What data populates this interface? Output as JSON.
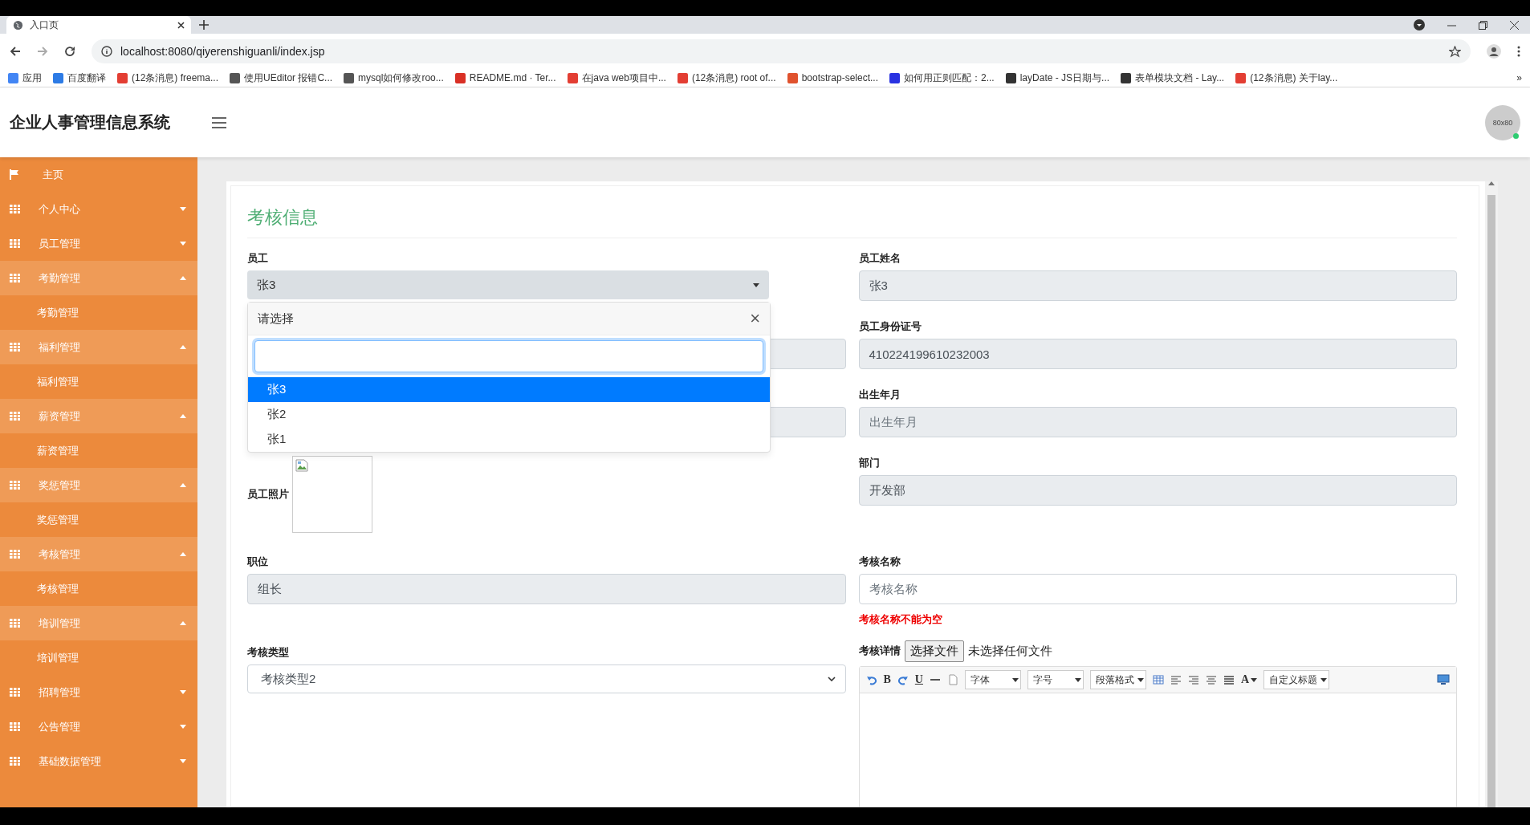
{
  "browser": {
    "tab_title": "入口页",
    "url": "localhost:8080/qiyerenshiguanli/index.jsp",
    "bookmarks": [
      {
        "label": "应用",
        "color": "#4285f4"
      },
      {
        "label": "百度翻译",
        "color": "#2d7be5"
      },
      {
        "label": "(12条消息) freema...",
        "color": "#e33e33"
      },
      {
        "label": "使用UEditor 报错C...",
        "color": "#555555"
      },
      {
        "label": "mysql如何修改roo...",
        "color": "#555555"
      },
      {
        "label": "README.md · Ter...",
        "color": "#d93025"
      },
      {
        "label": "在java web项目中...",
        "color": "#e33e33"
      },
      {
        "label": "(12条消息) root of...",
        "color": "#e33e33"
      },
      {
        "label": "bootstrap-select...",
        "color": "#e0522e"
      },
      {
        "label": "如何用正则匹配：2...",
        "color": "#2932e1"
      },
      {
        "label": "layDate - JS日期与...",
        "color": "#333333"
      },
      {
        "label": "表单模块文档 - Lay...",
        "color": "#333333"
      },
      {
        "label": "(12条消息) 关于lay...",
        "color": "#e33e33"
      }
    ],
    "more": "»"
  },
  "app": {
    "title": "企业人事管理信息系统",
    "avatar": "80x80"
  },
  "sidebar": {
    "items": [
      {
        "label": "主页",
        "kind": "home"
      },
      {
        "label": "个人中心",
        "kind": "group",
        "expanded": false
      },
      {
        "label": "员工管理",
        "kind": "group",
        "expanded": false
      },
      {
        "label": "考勤管理",
        "kind": "group",
        "expanded": true,
        "children": [
          {
            "label": "考勤管理"
          }
        ]
      },
      {
        "label": "福利管理",
        "kind": "group",
        "expanded": true,
        "children": [
          {
            "label": "福利管理"
          }
        ]
      },
      {
        "label": "薪资管理",
        "kind": "group",
        "expanded": true,
        "children": [
          {
            "label": "薪资管理"
          }
        ]
      },
      {
        "label": "奖惩管理",
        "kind": "group",
        "expanded": true,
        "children": [
          {
            "label": "奖惩管理"
          }
        ]
      },
      {
        "label": "考核管理",
        "kind": "group",
        "expanded": true,
        "children": [
          {
            "label": "考核管理"
          }
        ]
      },
      {
        "label": "培训管理",
        "kind": "group",
        "expanded": true,
        "children": [
          {
            "label": "培训管理"
          }
        ]
      },
      {
        "label": "招聘管理",
        "kind": "group",
        "expanded": false
      },
      {
        "label": "公告管理",
        "kind": "group",
        "expanded": false
      },
      {
        "label": "基础数据管理",
        "kind": "group",
        "expanded": false
      }
    ]
  },
  "form": {
    "title": "考核信息",
    "employee": {
      "label": "员工",
      "value": "张3",
      "dropdown": {
        "header": "请选择",
        "close": "×",
        "options": [
          {
            "label": "张3",
            "selected": true
          },
          {
            "label": "张2",
            "selected": false
          },
          {
            "label": "张1",
            "selected": false
          }
        ]
      }
    },
    "photo": {
      "label": "员工照片"
    },
    "position": {
      "label": "职位",
      "value": "组长"
    },
    "assessment_type": {
      "label": "考核类型",
      "value": "考核类型2"
    },
    "employee_name": {
      "label": "员工姓名",
      "value": "张3"
    },
    "id_number": {
      "label": "员工身份证号",
      "value": "410224199610232003"
    },
    "birth": {
      "label": "出生年月",
      "placeholder": "出生年月"
    },
    "department": {
      "label": "部门",
      "value": "开发部"
    },
    "assessment_name": {
      "label": "考核名称",
      "placeholder": "考核名称",
      "error": "考核名称不能为空"
    },
    "details": {
      "label": "考核详情",
      "file_button": "选择文件",
      "file_status": "未选择任何文件",
      "toolbar": [
        {
          "kind": "undo"
        },
        {
          "kind": "char",
          "label": "B"
        },
        {
          "kind": "redo"
        },
        {
          "kind": "char",
          "label": "U",
          "underline": true
        },
        {
          "kind": "hr"
        },
        {
          "kind": "page"
        },
        {
          "kind": "select",
          "label": "字体"
        },
        {
          "kind": "select",
          "label": "字号"
        },
        {
          "kind": "select",
          "label": "段落格式"
        },
        {
          "kind": "table"
        },
        {
          "kind": "align-left"
        },
        {
          "kind": "align-right"
        },
        {
          "kind": "align-center"
        },
        {
          "kind": "justify"
        },
        {
          "kind": "char",
          "label": "A",
          "caret": true
        },
        {
          "kind": "select",
          "label": "自定义标题"
        },
        {
          "kind": "preview"
        }
      ]
    }
  }
}
